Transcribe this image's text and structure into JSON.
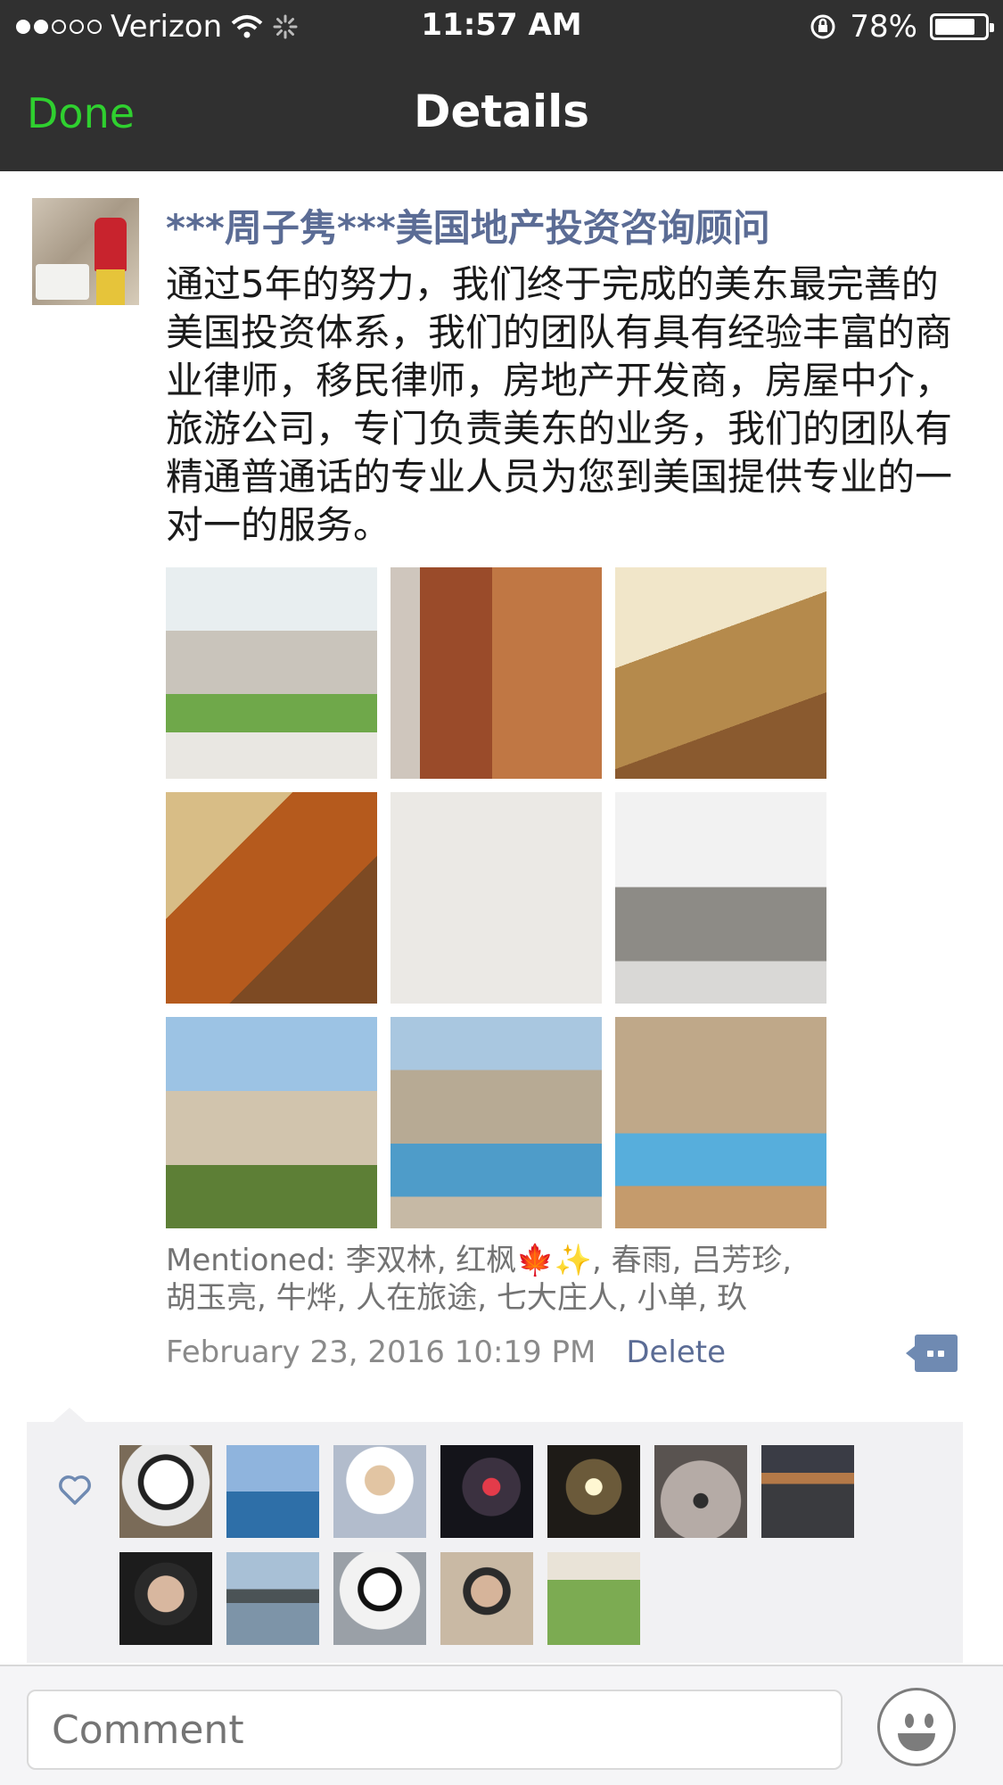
{
  "status_bar": {
    "carrier": "Verizon",
    "time": "11:57 AM",
    "battery": "78%",
    "signal_filled": 2,
    "signal_total": 5
  },
  "nav": {
    "done_label": "Done",
    "title": "Details"
  },
  "post": {
    "author": "***周子隽***美国地产投资咨询顾问",
    "content": "通过5年的努力，我们终于完成的美东最完善的美国投资体系，我们的团队有具有经验丰富的商业律师，移民律师，房地产开发商，房屋中介，旅游公司，专门负责美东的业务，我们的团队有精通普通话的专业人员为您到美国提供专业的一对一的服务。",
    "mentioned_line1": "Mentioned: 李双林, 红枫🍁✨, 春雨, 吕芳珍,",
    "mentioned_line2": "胡玉亮, 牛烨, 人在旅途, 七大庄人, 小单, 玖",
    "timestamp": "February 23, 2016 10:19 PM",
    "delete_label": "Delete",
    "photos": [
      "house-exterior-photo",
      "kitchen-photo",
      "living-room-photo",
      "spiral-staircase-photo",
      "blank-photo",
      "ping-pong-room-photo",
      "balcony-photo",
      "pool-house-photo",
      "backyard-pool-photo"
    ]
  },
  "likes": {
    "count": 12,
    "icon": "heart-icon"
  },
  "comment_bar": {
    "placeholder": "Comment",
    "emoji_icon": "smiley-icon"
  },
  "colors": {
    "nav_bg": "#303030",
    "done_green": "#2fd02f",
    "link_blue": "#5b6c95",
    "likes_bg": "#f1f1f3"
  }
}
